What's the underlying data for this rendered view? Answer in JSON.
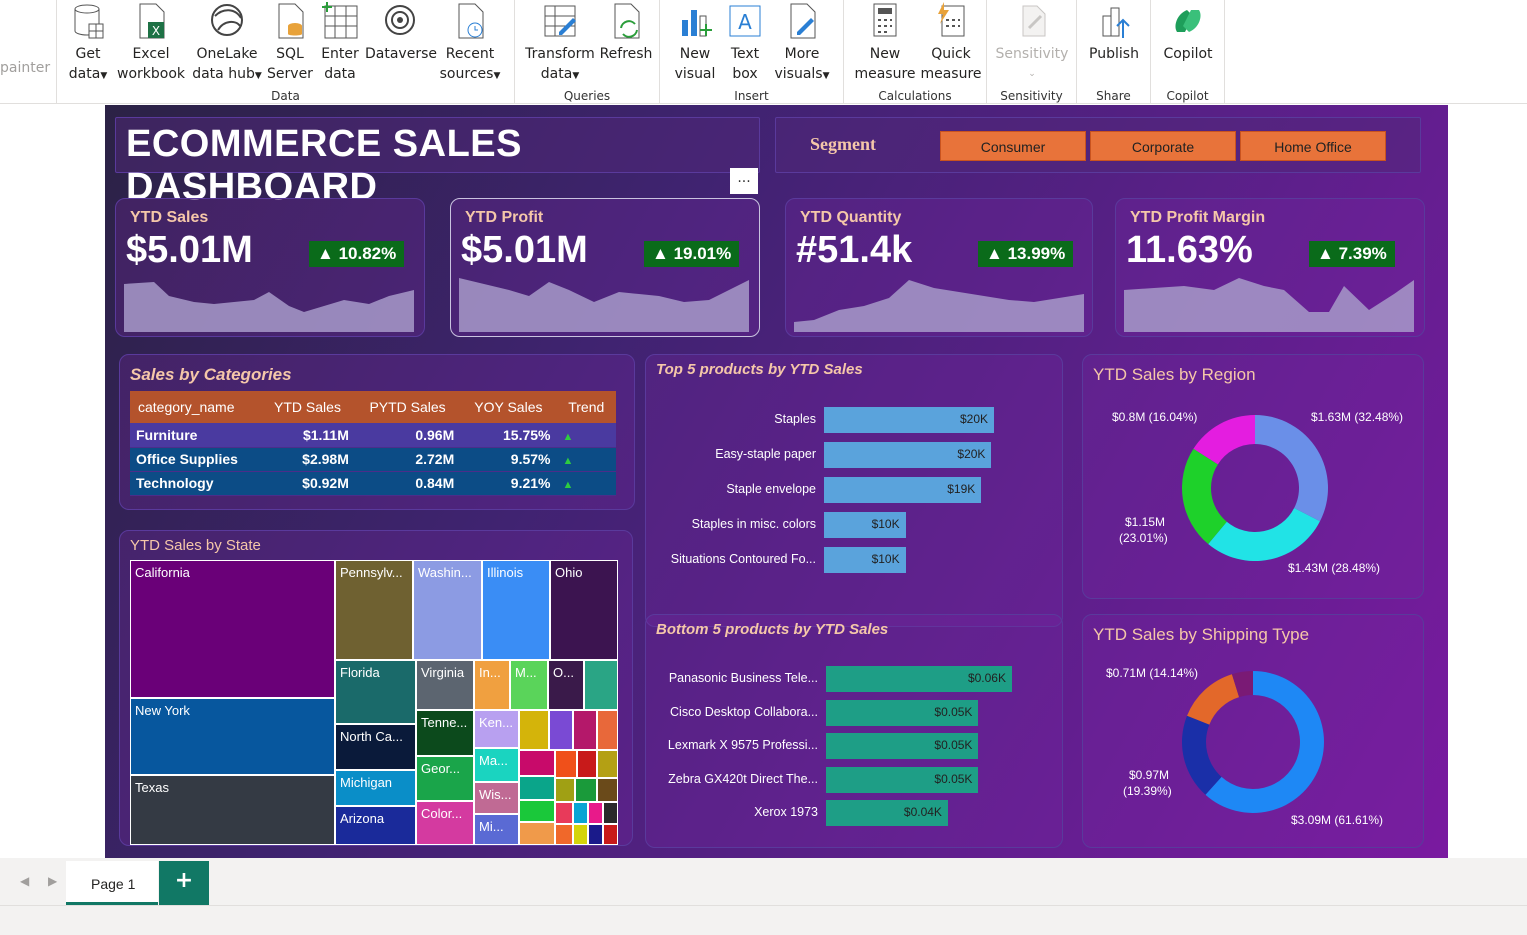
{
  "ribbon": {
    "left_cut": "painter",
    "data_group": {
      "label": "Data",
      "buttons": [
        {
          "l1": "Get",
          "l2": "data",
          "caret": true
        },
        {
          "l1": "Excel",
          "l2": "workbook",
          "caret": false
        },
        {
          "l1": "OneLake",
          "l2": "data hub",
          "caret": true
        },
        {
          "l1": "SQL",
          "l2": "Server",
          "caret": false
        },
        {
          "l1": "Enter",
          "l2": "data",
          "caret": false
        },
        {
          "l1": "Dataverse",
          "l2": "",
          "caret": false
        },
        {
          "l1": "Recent",
          "l2": "sources",
          "caret": true
        }
      ]
    },
    "queries_group": {
      "label": "Queries",
      "buttons": [
        {
          "l1": "Transform",
          "l2": "data",
          "caret": true
        },
        {
          "l1": "Refresh",
          "l2": "",
          "caret": false
        }
      ]
    },
    "insert_group": {
      "label": "Insert",
      "buttons": [
        {
          "l1": "New",
          "l2": "visual",
          "caret": false
        },
        {
          "l1": "Text",
          "l2": "box",
          "caret": false
        },
        {
          "l1": "More",
          "l2": "visuals",
          "caret": true
        }
      ]
    },
    "calc_group": {
      "label": "Calculations",
      "buttons": [
        {
          "l1": "New",
          "l2": "measure",
          "caret": false
        },
        {
          "l1": "Quick",
          "l2": "measure",
          "caret": false
        }
      ]
    },
    "sensitivity_group": {
      "label": "Sensitivity",
      "button": "Sensitivity"
    },
    "share_group": {
      "label": "Share",
      "button": "Publish"
    },
    "copilot_group": {
      "label": "Copilot",
      "button": "Copilot"
    }
  },
  "dashboard": {
    "title": "ECOMMERCE SALES DASHBOARD",
    "segment_label": "Segment",
    "segments": [
      "Consumer",
      "Corporate",
      "Home Office"
    ],
    "more_options": "...",
    "kpis": [
      {
        "title": "YTD Sales",
        "value": "$5.01M",
        "change": "10.82%"
      },
      {
        "title": "YTD Profit",
        "value": "$5.01M",
        "change": "19.01%"
      },
      {
        "title": "YTD Quantity",
        "value": "#51.4k",
        "change": "13.99%"
      },
      {
        "title": "YTD Profit Margin",
        "value": "11.63%",
        "change": "7.39%"
      }
    ],
    "categories": {
      "title": "Sales by Categories",
      "headers": [
        "category_name",
        "YTD Sales",
        "PYTD Sales",
        "YOY Sales",
        "Trend"
      ],
      "rows": [
        [
          "Furniture",
          "$1.11M",
          "0.96M",
          "15.75%"
        ],
        [
          "Office Supplies",
          "$2.98M",
          "2.72M",
          "9.57%"
        ],
        [
          "Technology",
          "$0.92M",
          "0.84M",
          "9.21%"
        ]
      ]
    },
    "top5": {
      "title": "Top 5 products by YTD Sales",
      "items": [
        {
          "name": "Staples",
          "label": "$20K",
          "value": 20
        },
        {
          "name": "Easy-staple paper",
          "label": "$20K",
          "value": 19.7
        },
        {
          "name": "Staple envelope",
          "label": "$19K",
          "value": 18.5
        },
        {
          "name": "Staples in misc. colors",
          "label": "$10K",
          "value": 9.6
        },
        {
          "name": "Situations Contoured Fo...",
          "label": "$10K",
          "value": 9.6
        }
      ]
    },
    "bottom5": {
      "title": "Bottom 5 products by YTD Sales",
      "items": [
        {
          "name": "Panasonic Business Tele...",
          "label": "$0.06K",
          "value": 0.061
        },
        {
          "name": "Cisco Desktop Collabora...",
          "label": "$0.05K",
          "value": 0.05
        },
        {
          "name": "Lexmark X 9575 Professi...",
          "label": "$0.05K",
          "value": 0.05
        },
        {
          "name": "Zebra GX420t Direct The...",
          "label": "$0.05K",
          "value": 0.05
        },
        {
          "name": "Xerox 1973",
          "label": "$0.04K",
          "value": 0.04
        }
      ]
    },
    "region": {
      "title": "YTD Sales by Region",
      "labels": [
        "$1.63M (32.48%)",
        "$1.43M (28.48%)",
        "$1.15M",
        "(23.01%)",
        "$0.8M (16.04%)"
      ]
    },
    "shipping": {
      "title": "YTD Sales by Shipping Type",
      "labels": [
        "$3.09M (61.61%)",
        "$0.97M",
        "(19.39%)",
        "$0.71M (14.14%)"
      ]
    },
    "state": {
      "title": "YTD Sales by State",
      "tiles": [
        "California",
        "New York",
        "Texas",
        "Pennsylv...",
        "Washin...",
        "Illinois",
        "Ohio",
        "Florida",
        "Virginia",
        "In...",
        "M...",
        "O...",
        "North Ca...",
        "Tenne...",
        "Ken...",
        "Michigan",
        "Geor...",
        "Ma...",
        "Arizona",
        "Color...",
        "Wis...",
        "Mi..."
      ]
    }
  },
  "pages": {
    "tab": "Page 1",
    "add": "+"
  },
  "chart_data": [
    {
      "type": "bar",
      "title": "Top 5 products by YTD Sales",
      "categories": [
        "Staples",
        "Easy-staple paper",
        "Staple envelope",
        "Staples in misc. colors",
        "Situations Contoured Fo..."
      ],
      "values": [
        20,
        19.7,
        18.5,
        9.6,
        9.6
      ]
    },
    {
      "type": "bar",
      "title": "Bottom 5 products by YTD Sales",
      "categories": [
        "Panasonic Business Tele...",
        "Cisco Desktop Collabora...",
        "Lexmark X 9575 Professi...",
        "Zebra GX420t Direct The...",
        "Xerox 1973"
      ],
      "values": [
        0.061,
        0.05,
        0.05,
        0.05,
        0.04
      ]
    },
    {
      "type": "pie",
      "title": "YTD Sales by Region",
      "values": [
        1.63,
        1.43,
        1.15,
        0.8
      ],
      "percent": [
        32.48,
        28.48,
        23.01,
        16.04
      ],
      "colors": [
        "#6a8fe8",
        "#21e3e6",
        "#1ed12a",
        "#e41de0"
      ]
    },
    {
      "type": "pie",
      "title": "YTD Sales by Shipping Type",
      "values": [
        3.09,
        0.97,
        0.71,
        0.24
      ],
      "percent": [
        61.61,
        19.39,
        14.14,
        4.86
      ],
      "colors": [
        "#1e88f5",
        "#1a2fa8",
        "#e3682a",
        "#7a1a75"
      ]
    }
  ]
}
